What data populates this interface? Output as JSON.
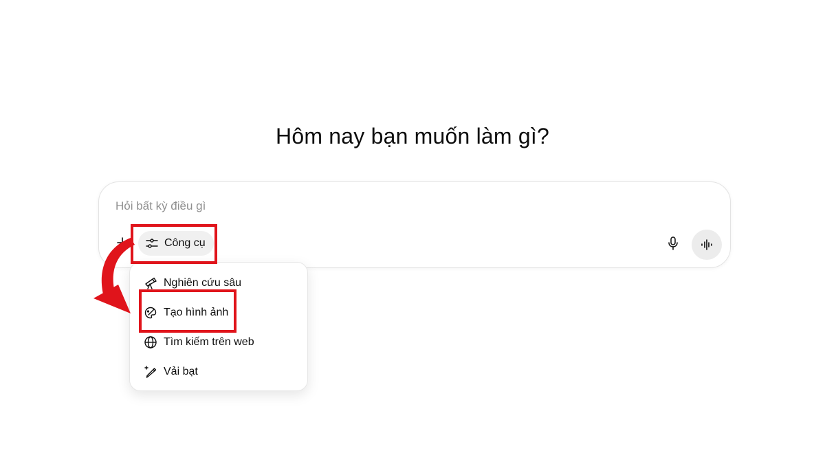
{
  "heading": "Hôm nay bạn muốn làm gì?",
  "composer": {
    "placeholder": "Hỏi bất kỳ điều gì",
    "value": "",
    "plus_icon": "plus-icon",
    "tools_label": "Công cụ",
    "tools_icon": "sliders-icon",
    "mic_icon": "microphone-icon",
    "voice_icon": "voice-waveform-icon"
  },
  "tools_menu": {
    "items": [
      {
        "label": "Nghiên cứu sâu",
        "icon": "telescope-icon"
      },
      {
        "label": "Tạo hình ảnh",
        "icon": "palette-icon"
      },
      {
        "label": "Tìm kiếm trên web",
        "icon": "globe-icon"
      },
      {
        "label": "Vải bạt",
        "icon": "canvas-pen-icon"
      }
    ]
  },
  "annotations": {
    "highlight_color": "#e0141b",
    "arrow_color": "#e0141b"
  }
}
